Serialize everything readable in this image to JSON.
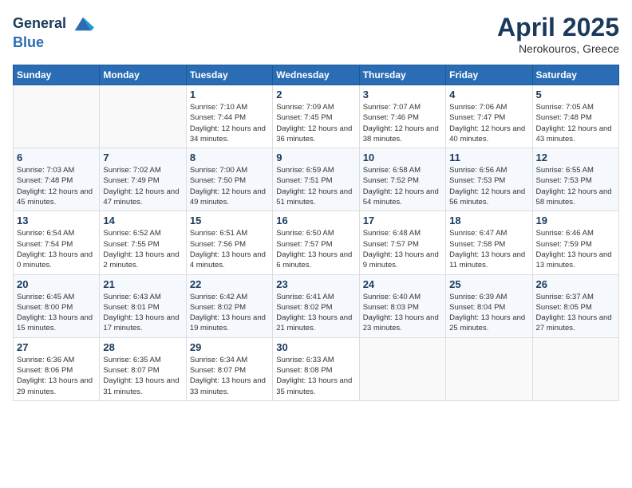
{
  "header": {
    "logo_line1": "General",
    "logo_line2": "Blue",
    "month": "April 2025",
    "location": "Nerokouros, Greece"
  },
  "days_of_week": [
    "Sunday",
    "Monday",
    "Tuesday",
    "Wednesday",
    "Thursday",
    "Friday",
    "Saturday"
  ],
  "weeks": [
    [
      {
        "day": "",
        "info": ""
      },
      {
        "day": "",
        "info": ""
      },
      {
        "day": "1",
        "info": "Sunrise: 7:10 AM\nSunset: 7:44 PM\nDaylight: 12 hours\nand 34 minutes."
      },
      {
        "day": "2",
        "info": "Sunrise: 7:09 AM\nSunset: 7:45 PM\nDaylight: 12 hours\nand 36 minutes."
      },
      {
        "day": "3",
        "info": "Sunrise: 7:07 AM\nSunset: 7:46 PM\nDaylight: 12 hours\nand 38 minutes."
      },
      {
        "day": "4",
        "info": "Sunrise: 7:06 AM\nSunset: 7:47 PM\nDaylight: 12 hours\nand 40 minutes."
      },
      {
        "day": "5",
        "info": "Sunrise: 7:05 AM\nSunset: 7:48 PM\nDaylight: 12 hours\nand 43 minutes."
      }
    ],
    [
      {
        "day": "6",
        "info": "Sunrise: 7:03 AM\nSunset: 7:48 PM\nDaylight: 12 hours\nand 45 minutes."
      },
      {
        "day": "7",
        "info": "Sunrise: 7:02 AM\nSunset: 7:49 PM\nDaylight: 12 hours\nand 47 minutes."
      },
      {
        "day": "8",
        "info": "Sunrise: 7:00 AM\nSunset: 7:50 PM\nDaylight: 12 hours\nand 49 minutes."
      },
      {
        "day": "9",
        "info": "Sunrise: 6:59 AM\nSunset: 7:51 PM\nDaylight: 12 hours\nand 51 minutes."
      },
      {
        "day": "10",
        "info": "Sunrise: 6:58 AM\nSunset: 7:52 PM\nDaylight: 12 hours\nand 54 minutes."
      },
      {
        "day": "11",
        "info": "Sunrise: 6:56 AM\nSunset: 7:53 PM\nDaylight: 12 hours\nand 56 minutes."
      },
      {
        "day": "12",
        "info": "Sunrise: 6:55 AM\nSunset: 7:53 PM\nDaylight: 12 hours\nand 58 minutes."
      }
    ],
    [
      {
        "day": "13",
        "info": "Sunrise: 6:54 AM\nSunset: 7:54 PM\nDaylight: 13 hours\nand 0 minutes."
      },
      {
        "day": "14",
        "info": "Sunrise: 6:52 AM\nSunset: 7:55 PM\nDaylight: 13 hours\nand 2 minutes."
      },
      {
        "day": "15",
        "info": "Sunrise: 6:51 AM\nSunset: 7:56 PM\nDaylight: 13 hours\nand 4 minutes."
      },
      {
        "day": "16",
        "info": "Sunrise: 6:50 AM\nSunset: 7:57 PM\nDaylight: 13 hours\nand 6 minutes."
      },
      {
        "day": "17",
        "info": "Sunrise: 6:48 AM\nSunset: 7:57 PM\nDaylight: 13 hours\nand 9 minutes."
      },
      {
        "day": "18",
        "info": "Sunrise: 6:47 AM\nSunset: 7:58 PM\nDaylight: 13 hours\nand 11 minutes."
      },
      {
        "day": "19",
        "info": "Sunrise: 6:46 AM\nSunset: 7:59 PM\nDaylight: 13 hours\nand 13 minutes."
      }
    ],
    [
      {
        "day": "20",
        "info": "Sunrise: 6:45 AM\nSunset: 8:00 PM\nDaylight: 13 hours\nand 15 minutes."
      },
      {
        "day": "21",
        "info": "Sunrise: 6:43 AM\nSunset: 8:01 PM\nDaylight: 13 hours\nand 17 minutes."
      },
      {
        "day": "22",
        "info": "Sunrise: 6:42 AM\nSunset: 8:02 PM\nDaylight: 13 hours\nand 19 minutes."
      },
      {
        "day": "23",
        "info": "Sunrise: 6:41 AM\nSunset: 8:02 PM\nDaylight: 13 hours\nand 21 minutes."
      },
      {
        "day": "24",
        "info": "Sunrise: 6:40 AM\nSunset: 8:03 PM\nDaylight: 13 hours\nand 23 minutes."
      },
      {
        "day": "25",
        "info": "Sunrise: 6:39 AM\nSunset: 8:04 PM\nDaylight: 13 hours\nand 25 minutes."
      },
      {
        "day": "26",
        "info": "Sunrise: 6:37 AM\nSunset: 8:05 PM\nDaylight: 13 hours\nand 27 minutes."
      }
    ],
    [
      {
        "day": "27",
        "info": "Sunrise: 6:36 AM\nSunset: 8:06 PM\nDaylight: 13 hours\nand 29 minutes."
      },
      {
        "day": "28",
        "info": "Sunrise: 6:35 AM\nSunset: 8:07 PM\nDaylight: 13 hours\nand 31 minutes."
      },
      {
        "day": "29",
        "info": "Sunrise: 6:34 AM\nSunset: 8:07 PM\nDaylight: 13 hours\nand 33 minutes."
      },
      {
        "day": "30",
        "info": "Sunrise: 6:33 AM\nSunset: 8:08 PM\nDaylight: 13 hours\nand 35 minutes."
      },
      {
        "day": "",
        "info": ""
      },
      {
        "day": "",
        "info": ""
      },
      {
        "day": "",
        "info": ""
      }
    ]
  ]
}
